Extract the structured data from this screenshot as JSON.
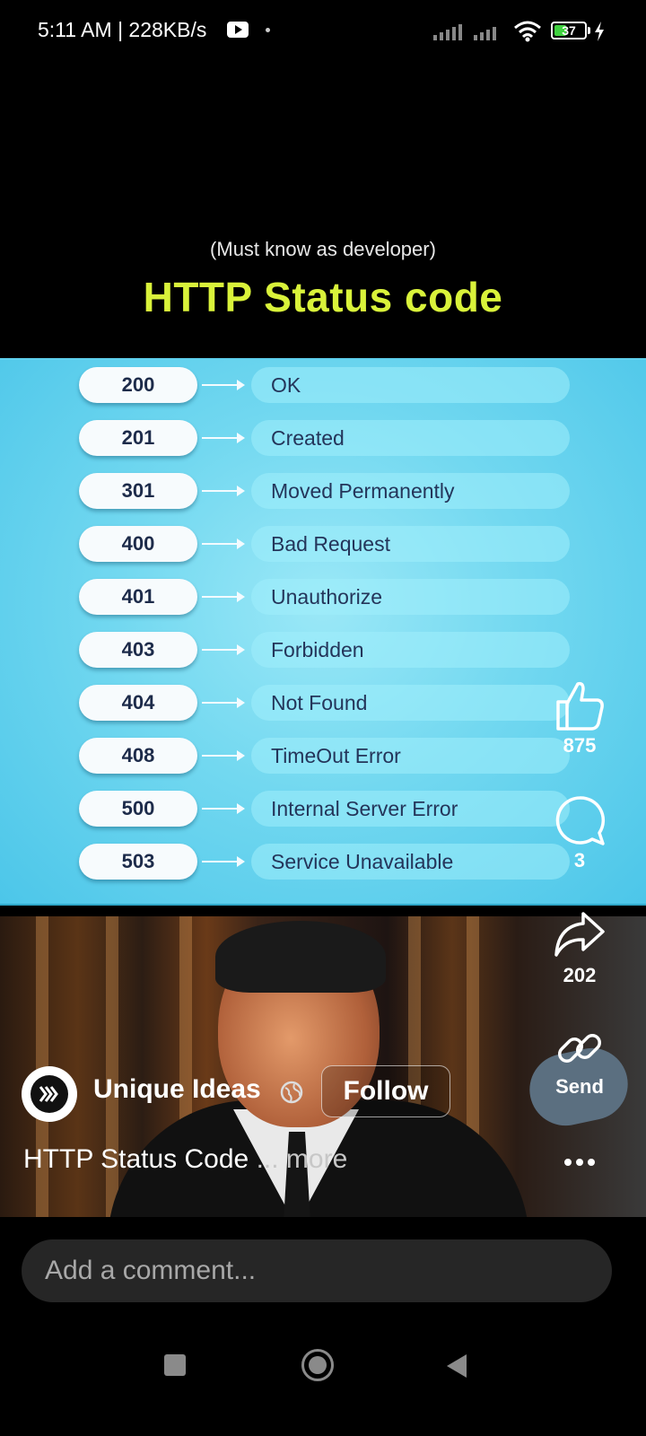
{
  "status_bar": {
    "time": "5:11 AM | 228KB/s",
    "battery": "37"
  },
  "video": {
    "subtitle": "(Must know as developer)",
    "headline": "HTTP Status code",
    "status_codes": [
      {
        "code": "200",
        "label": "OK"
      },
      {
        "code": "201",
        "label": "Created"
      },
      {
        "code": "301",
        "label": "Moved Permanently"
      },
      {
        "code": "400",
        "label": "Bad Request"
      },
      {
        "code": "401",
        "label": "Unauthorize"
      },
      {
        "code": "403",
        "label": "Forbidden"
      },
      {
        "code": "404",
        "label": "Not Found"
      },
      {
        "code": "408",
        "label": "TimeOut Error"
      },
      {
        "code": "500",
        "label": "Internal Server Error"
      },
      {
        "code": "503",
        "label": "Service Unavailable"
      }
    ]
  },
  "actions": {
    "likes": "875",
    "comments": "3",
    "shares": "202",
    "send_label": "Send"
  },
  "channel": {
    "name": "Unique Ideas",
    "follow_label": "Follow"
  },
  "caption": {
    "text": "HTTP Status Code",
    "more": "... more"
  },
  "comment": {
    "placeholder": "Add a comment..."
  },
  "icons": {
    "like": "thumbs-up-icon",
    "comment": "comment-bubble-icon",
    "share": "share-arrow-icon",
    "send": "link-icon",
    "options": "more-dots-icon"
  }
}
